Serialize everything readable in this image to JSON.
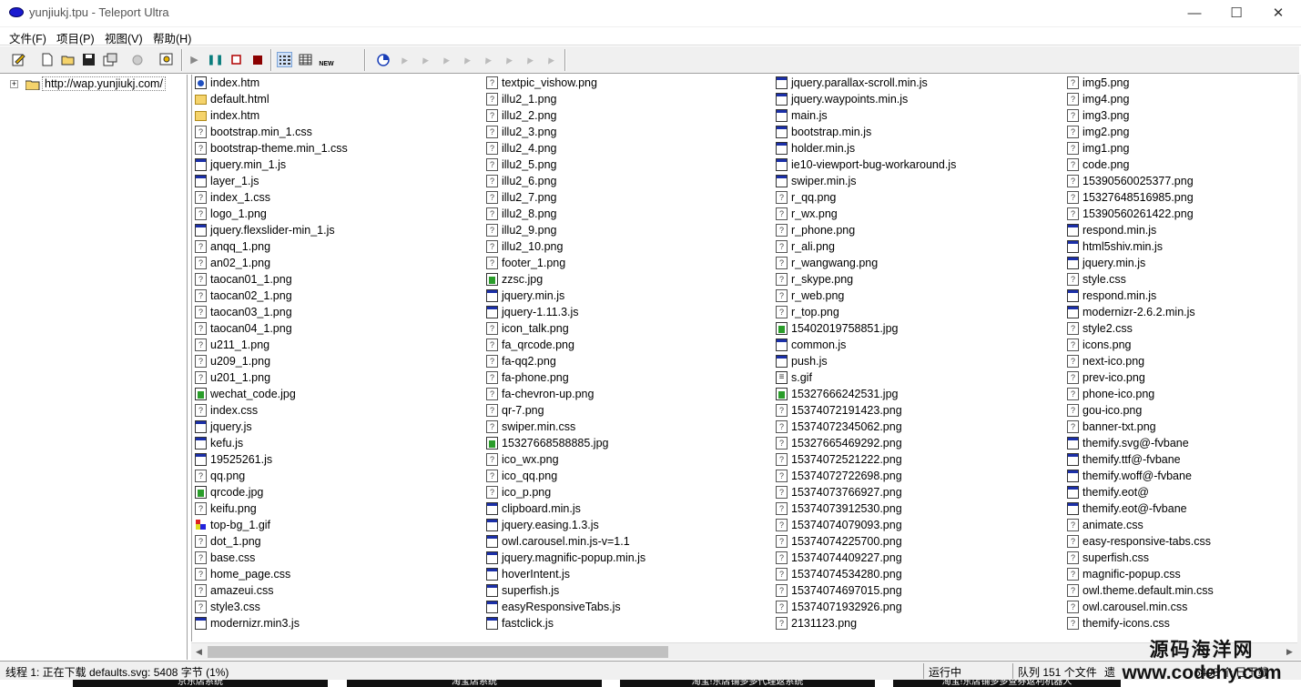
{
  "window": {
    "title": "yunjiukj.tpu - Teleport Ultra",
    "minimize": "—",
    "maximize": "☐",
    "close": "✕"
  },
  "menu": [
    "文件(F)",
    "项目(P)",
    "视图(V)",
    "帮助(H)"
  ],
  "toolbar": {
    "icons": [
      "edit-icon",
      "new-file-icon",
      "open-folder-icon",
      "save-icon",
      "properties-icon",
      "wizard-icon",
      "find-icon",
      "play-icon",
      "pause-icon",
      "stop-icon",
      "stop-all-icon",
      "small-icons-view-icon",
      "details-view-icon",
      "new-icon"
    ],
    "new_label": "NEW",
    "thread_count": 9
  },
  "tree": {
    "root": "http://wap.yunjiukj.com/",
    "expander": "+"
  },
  "files": [
    [
      {
        "n": "index.htm",
        "t": "web"
      },
      {
        "n": "default.html",
        "t": "folder"
      },
      {
        "n": "index.htm",
        "t": "folder"
      },
      {
        "n": "bootstrap.min_1.css",
        "t": "file"
      },
      {
        "n": "bootstrap-theme.min_1.css",
        "t": "file"
      },
      {
        "n": "jquery.min_1.js",
        "t": "script"
      },
      {
        "n": "layer_1.js",
        "t": "script"
      },
      {
        "n": "index_1.css",
        "t": "file"
      },
      {
        "n": "logo_1.png",
        "t": "file"
      },
      {
        "n": "jquery.flexslider-min_1.js",
        "t": "script"
      },
      {
        "n": "anqq_1.png",
        "t": "file"
      },
      {
        "n": "an02_1.png",
        "t": "file"
      },
      {
        "n": "taocan01_1.png",
        "t": "file"
      },
      {
        "n": "taocan02_1.png",
        "t": "file"
      },
      {
        "n": "taocan03_1.png",
        "t": "file"
      },
      {
        "n": "taocan04_1.png",
        "t": "file"
      },
      {
        "n": "u211_1.png",
        "t": "file"
      },
      {
        "n": "u209_1.png",
        "t": "file"
      },
      {
        "n": "u201_1.png",
        "t": "file"
      },
      {
        "n": "wechat_code.jpg",
        "t": "img"
      },
      {
        "n": "index.css",
        "t": "file"
      },
      {
        "n": "jquery.js",
        "t": "script"
      },
      {
        "n": "kefu.js",
        "t": "script"
      },
      {
        "n": "19525261.js",
        "t": "script"
      },
      {
        "n": "qq.png",
        "t": "file"
      },
      {
        "n": "qrcode.jpg",
        "t": "img"
      },
      {
        "n": "keifu.png",
        "t": "file"
      },
      {
        "n": "top-bg_1.gif",
        "t": "gif"
      },
      {
        "n": "dot_1.png",
        "t": "file"
      },
      {
        "n": "base.css",
        "t": "file"
      },
      {
        "n": "home_page.css",
        "t": "file"
      },
      {
        "n": "amazeui.css",
        "t": "file"
      },
      {
        "n": "style3.css",
        "t": "file"
      },
      {
        "n": "modernizr.min3.js",
        "t": "script"
      }
    ],
    [
      {
        "n": "textpic_vishow.png",
        "t": "file"
      },
      {
        "n": "illu2_1.png",
        "t": "file"
      },
      {
        "n": "illu2_2.png",
        "t": "file"
      },
      {
        "n": "illu2_3.png",
        "t": "file"
      },
      {
        "n": "illu2_4.png",
        "t": "file"
      },
      {
        "n": "illu2_5.png",
        "t": "file"
      },
      {
        "n": "illu2_6.png",
        "t": "file"
      },
      {
        "n": "illu2_7.png",
        "t": "file"
      },
      {
        "n": "illu2_8.png",
        "t": "file"
      },
      {
        "n": "illu2_9.png",
        "t": "file"
      },
      {
        "n": "illu2_10.png",
        "t": "file"
      },
      {
        "n": "footer_1.png",
        "t": "file"
      },
      {
        "n": "zzsc.jpg",
        "t": "img"
      },
      {
        "n": "jquery.min.js",
        "t": "script"
      },
      {
        "n": "jquery-1.11.3.js",
        "t": "script"
      },
      {
        "n": "icon_talk.png",
        "t": "file"
      },
      {
        "n": "fa_qrcode.png",
        "t": "file"
      },
      {
        "n": "fa-qq2.png",
        "t": "file"
      },
      {
        "n": "fa-phone.png",
        "t": "file"
      },
      {
        "n": "fa-chevron-up.png",
        "t": "file"
      },
      {
        "n": "qr-7.png",
        "t": "file"
      },
      {
        "n": "swiper.min.css",
        "t": "file"
      },
      {
        "n": "15327668588885.jpg",
        "t": "img"
      },
      {
        "n": "ico_wx.png",
        "t": "file"
      },
      {
        "n": "ico_qq.png",
        "t": "file"
      },
      {
        "n": "ico_p.png",
        "t": "file"
      },
      {
        "n": "clipboard.min.js",
        "t": "script"
      },
      {
        "n": "jquery.easing.1.3.js",
        "t": "script"
      },
      {
        "n": "owl.carousel.min.js-v=1.1",
        "t": "script"
      },
      {
        "n": "jquery.magnific-popup.min.js",
        "t": "script"
      },
      {
        "n": "hoverIntent.js",
        "t": "script"
      },
      {
        "n": "superfish.js",
        "t": "script"
      },
      {
        "n": "easyResponsiveTabs.js",
        "t": "script"
      },
      {
        "n": "fastclick.js",
        "t": "script"
      }
    ],
    [
      {
        "n": "jquery.parallax-scroll.min.js",
        "t": "script"
      },
      {
        "n": "jquery.waypoints.min.js",
        "t": "script"
      },
      {
        "n": "main.js",
        "t": "script"
      },
      {
        "n": "bootstrap.min.js",
        "t": "script"
      },
      {
        "n": "holder.min.js",
        "t": "script"
      },
      {
        "n": "ie10-viewport-bug-workaround.js",
        "t": "script"
      },
      {
        "n": "swiper.min.js",
        "t": "script"
      },
      {
        "n": "r_qq.png",
        "t": "file"
      },
      {
        "n": "r_wx.png",
        "t": "file"
      },
      {
        "n": "r_phone.png",
        "t": "file"
      },
      {
        "n": "r_ali.png",
        "t": "file"
      },
      {
        "n": "r_wangwang.png",
        "t": "file"
      },
      {
        "n": "r_skype.png",
        "t": "file"
      },
      {
        "n": "r_web.png",
        "t": "file"
      },
      {
        "n": "r_top.png",
        "t": "file"
      },
      {
        "n": "15402019758851.jpg",
        "t": "img"
      },
      {
        "n": "common.js",
        "t": "script"
      },
      {
        "n": "push.js",
        "t": "script"
      },
      {
        "n": "s.gif",
        "t": "doc"
      },
      {
        "n": "15327666242531.jpg",
        "t": "img"
      },
      {
        "n": "15374072191423.png",
        "t": "file"
      },
      {
        "n": "15374072345062.png",
        "t": "file"
      },
      {
        "n": "15327665469292.png",
        "t": "file"
      },
      {
        "n": "15374072521222.png",
        "t": "file"
      },
      {
        "n": "15374072722698.png",
        "t": "file"
      },
      {
        "n": "15374073766927.png",
        "t": "file"
      },
      {
        "n": "15374073912530.png",
        "t": "file"
      },
      {
        "n": "15374074079093.png",
        "t": "file"
      },
      {
        "n": "15374074225700.png",
        "t": "file"
      },
      {
        "n": "15374074409227.png",
        "t": "file"
      },
      {
        "n": "15374074534280.png",
        "t": "file"
      },
      {
        "n": "15374074697015.png",
        "t": "file"
      },
      {
        "n": "15374071932926.png",
        "t": "file"
      },
      {
        "n": "2131123.png",
        "t": "file"
      }
    ],
    [
      {
        "n": "img5.png",
        "t": "file"
      },
      {
        "n": "img4.png",
        "t": "file"
      },
      {
        "n": "img3.png",
        "t": "file"
      },
      {
        "n": "img2.png",
        "t": "file"
      },
      {
        "n": "img1.png",
        "t": "file"
      },
      {
        "n": "code.png",
        "t": "file"
      },
      {
        "n": "15390560025377.png",
        "t": "file"
      },
      {
        "n": "15327648516985.png",
        "t": "file"
      },
      {
        "n": "15390560261422.png",
        "t": "file"
      },
      {
        "n": "respond.min.js",
        "t": "script"
      },
      {
        "n": "html5shiv.min.js",
        "t": "script"
      },
      {
        "n": "jquery.min.js",
        "t": "script"
      },
      {
        "n": "style.css",
        "t": "file"
      },
      {
        "n": "respond.min.js",
        "t": "script"
      },
      {
        "n": "modernizr-2.6.2.min.js",
        "t": "script"
      },
      {
        "n": "style2.css",
        "t": "file"
      },
      {
        "n": "icons.png",
        "t": "file"
      },
      {
        "n": "next-ico.png",
        "t": "file"
      },
      {
        "n": "prev-ico.png",
        "t": "file"
      },
      {
        "n": "phone-ico.png",
        "t": "file"
      },
      {
        "n": "gou-ico.png",
        "t": "file"
      },
      {
        "n": "banner-txt.png",
        "t": "file"
      },
      {
        "n": "themify.svg@-fvbane",
        "t": "script"
      },
      {
        "n": "themify.ttf@-fvbane",
        "t": "script"
      },
      {
        "n": "themify.woff@-fvbane",
        "t": "script"
      },
      {
        "n": "themify.eot@",
        "t": "script"
      },
      {
        "n": "themify.eot@-fvbane",
        "t": "script"
      },
      {
        "n": "animate.css",
        "t": "file"
      },
      {
        "n": "easy-responsive-tabs.css",
        "t": "file"
      },
      {
        "n": "superfish.css",
        "t": "file"
      },
      {
        "n": "magnific-popup.css",
        "t": "file"
      },
      {
        "n": "owl.theme.default.min.css",
        "t": "file"
      },
      {
        "n": "owl.carousel.min.css",
        "t": "file"
      },
      {
        "n": "themify-icons.css",
        "t": "file"
      }
    ]
  ],
  "status": {
    "thread": "线程 1: 正在下载 defaults.svg: 5408 字节 (1%)",
    "state": "运行中",
    "queue": "队列 151 个文件",
    "extra": "遗",
    "count": "5408 个 已下载"
  },
  "bottom_tabs": [
    "京东店系统",
    "淘宝店系统",
    "淘宝!东店铺多多代理返系统",
    "淘宝!东店铺多多查券返利机器人"
  ],
  "watermark": {
    "line1": "源码海洋网",
    "line2": "www.codehy.com"
  }
}
